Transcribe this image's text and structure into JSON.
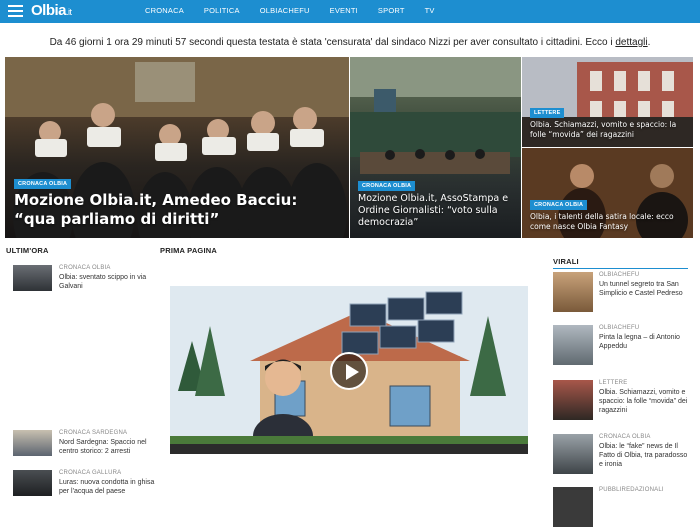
{
  "brand": {
    "logo_text": "Olbia",
    "logo_suffix": ".it",
    "accent": "#1d8ed0"
  },
  "nav": {
    "menu_icon": "hamburger-menu-icon",
    "items": [
      "CRONACA",
      "POLITICA",
      "OLBIACHEFU",
      "EVENTI",
      "SPORT",
      "TV"
    ]
  },
  "notice": {
    "text": "Da 46 giorni 1 ora 29 minuti 57 secondi questa testata è stata 'censurata' dal sindaco Nizzi per aver consultato i cittadini. Ecco i ",
    "link": "dettagli",
    "end": "."
  },
  "hero": [
    {
      "category": "CRONACA OLBIA",
      "title": "Mozione Olbia.it, Amedeo Bacciu: “qua parliamo di diritti”"
    },
    {
      "category": "CRONACA OLBIA",
      "title": "Mozione Olbia.it, AssoStampa e Ordine Giornalisti: “voto sulla democrazia”"
    },
    {
      "category": "LETTERE",
      "title": "Olbia. Schiamazzi, vomito e spaccio: la folle “movida” dei ragazzini"
    },
    {
      "category": "CRONACA OLBIA",
      "title": "Olbia, i talenti della satira locale: ecco come nasce Olbia Fantasy"
    }
  ],
  "sections": {
    "latest": "ULTIM'ORA",
    "front": "PRIMA PAGINA",
    "viral": "VIRALI"
  },
  "latest": [
    {
      "category": "CRONACA OLBIA",
      "text": "Olbia: sventato scippo in via Galvani"
    },
    {
      "category": "CRONACA SARDEGNA",
      "text": "Nord Sardegna: Spaccio nel centro storico: 2 arresti"
    },
    {
      "category": "CRONACA GALLURA",
      "text": "Luras: nuova condotta in ghisa per l'acqua del paese"
    }
  ],
  "viral": [
    {
      "category": "OLBIACHEFU",
      "text": "Un tunnel segreto tra San Simplicio e Castel Pedreso"
    },
    {
      "category": "OLBIACHEFU",
      "text": "Pinta la legna – di Antonio Appeddu"
    },
    {
      "category": "LETTERE",
      "text": "Olbia. Schiamazzi, vomito e spaccio: la folle “movida” dei ragazzini"
    },
    {
      "category": "CRONACA OLBIA",
      "text": "Olbia: le “fake” news de Il Fatto di Olbia, tra paradosso e ironia"
    },
    {
      "category": "PUBBLIREDAZIONALI",
      "text": ""
    }
  ],
  "video": {
    "play_icon": "play-icon"
  }
}
